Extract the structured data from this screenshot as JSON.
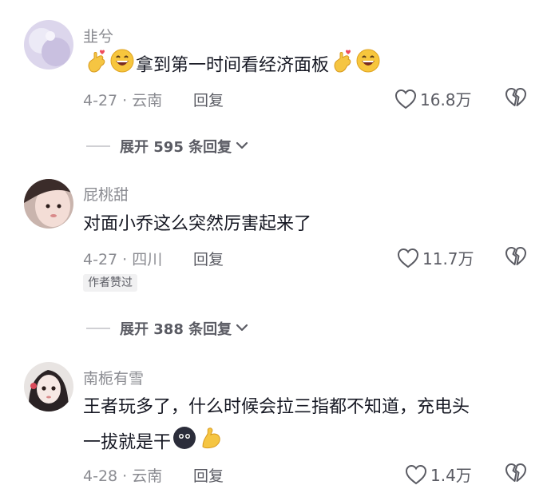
{
  "comments": [
    {
      "username": "韭兮",
      "text": "拿到第一时间看经济面板",
      "date_location": "4-27 · 云南",
      "reply_label": "回复",
      "likes": "16.8万",
      "avatar_color": "#d9d2ea"
    },
    {
      "username": "屁桃甜",
      "text": "对面小乔这么突然厉害起来了",
      "date_location": "4-27 · 四川",
      "reply_label": "回复",
      "likes": "11.7万",
      "badge": "作者赞过",
      "avatar_color": "#e9d4cc"
    },
    {
      "username": "南栀有雪",
      "text_line1": "王者玩多了，什么时候会拉三指都不知道，充电头",
      "text_line2": "一拔就是干",
      "date_location": "4-28 · 云南",
      "reply_label": "回复",
      "likes": "1.4万",
      "avatar_color": "#e7e2e0"
    }
  ],
  "expand_replies": [
    {
      "label": "展开 595 条回复"
    },
    {
      "label": "展开 388 条回复"
    }
  ],
  "icons": {
    "like": "heart-outline-icon",
    "dislike": "broken-heart-icon",
    "expand": "chevron-down-icon",
    "emoji_hand": "finger-heart-emoji",
    "emoji_grin": "grinning-face-emoji",
    "emoji_dark": "dark-face-emoji",
    "emoji_muscle": "flexed-bicep-emoji"
  }
}
